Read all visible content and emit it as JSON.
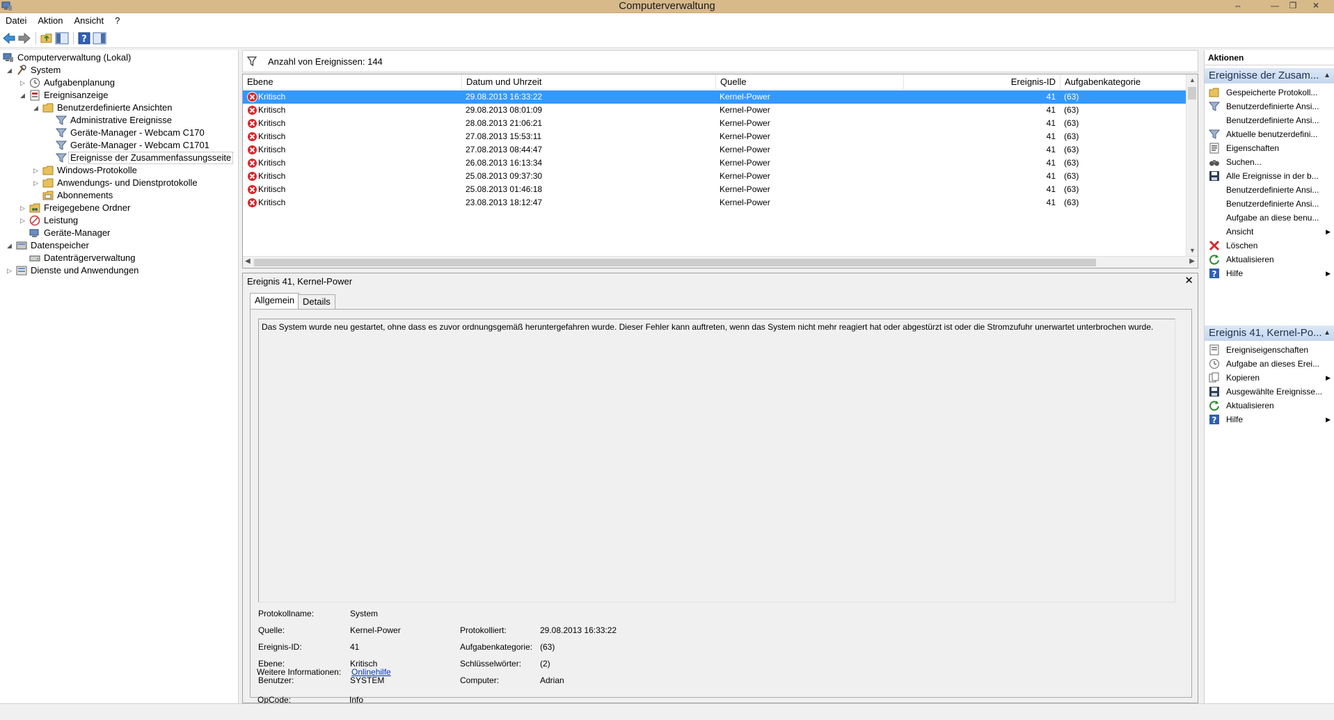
{
  "window": {
    "title": "Computerverwaltung",
    "buttons": {
      "resize": "⇔",
      "minimize": "—",
      "maximize": "❐",
      "close": "✕"
    }
  },
  "menu": {
    "items": [
      "Datei",
      "Aktion",
      "Ansicht",
      "?"
    ]
  },
  "tree": {
    "items": [
      {
        "label": "Computerverwaltung (Lokal)",
        "icon": "computer-management-icon"
      },
      {
        "label": "System",
        "icon": "system-tools-icon"
      },
      {
        "label": "Aufgabenplanung",
        "icon": "clock-icon"
      },
      {
        "label": "Ereignisanzeige",
        "icon": "event-viewer-icon"
      },
      {
        "label": "Benutzerdefinierte Ansichten",
        "icon": "folder-icon"
      },
      {
        "label": "Administrative Ereignisse",
        "icon": "filter-icon"
      },
      {
        "label": "Geräte-Manager - Webcam C170",
        "icon": "filter-icon"
      },
      {
        "label": "Geräte-Manager - Webcam C1701",
        "icon": "filter-icon"
      },
      {
        "label": "Ereignisse der Zusammenfassungsseite",
        "icon": "filter-icon"
      },
      {
        "label": "Windows-Protokolle",
        "icon": "folder-icon"
      },
      {
        "label": "Anwendungs- und Dienstprotokolle",
        "icon": "folder-icon"
      },
      {
        "label": "Abonnements",
        "icon": "subscription-icon"
      },
      {
        "label": "Freigegebene Ordner",
        "icon": "shared-folder-icon"
      },
      {
        "label": "Leistung",
        "icon": "performance-icon"
      },
      {
        "label": "Geräte-Manager",
        "icon": "device-manager-icon"
      },
      {
        "label": "Datenspeicher",
        "icon": "storage-icon"
      },
      {
        "label": "Datenträgerverwaltung",
        "icon": "disk-icon"
      },
      {
        "label": "Dienste und Anwendungen",
        "icon": "services-icon"
      }
    ]
  },
  "events": {
    "filter_text": "Anzahl von Ereignissen: 144",
    "columns": [
      "Ebene",
      "Datum und Uhrzeit",
      "Quelle",
      "Ereignis-ID",
      "Aufgabenkategorie"
    ],
    "rows": [
      {
        "level": "Kritisch",
        "datetime": "29.08.2013 16:33:22",
        "source": "Kernel-Power",
        "id": "41",
        "category": "(63)"
      },
      {
        "level": "Kritisch",
        "datetime": "29.08.2013 08:01:09",
        "source": "Kernel-Power",
        "id": "41",
        "category": "(63)"
      },
      {
        "level": "Kritisch",
        "datetime": "28.08.2013 21:06:21",
        "source": "Kernel-Power",
        "id": "41",
        "category": "(63)"
      },
      {
        "level": "Kritisch",
        "datetime": "27.08.2013 15:53:11",
        "source": "Kernel-Power",
        "id": "41",
        "category": "(63)"
      },
      {
        "level": "Kritisch",
        "datetime": "27.08.2013 08:44:47",
        "source": "Kernel-Power",
        "id": "41",
        "category": "(63)"
      },
      {
        "level": "Kritisch",
        "datetime": "26.08.2013 16:13:34",
        "source": "Kernel-Power",
        "id": "41",
        "category": "(63)"
      },
      {
        "level": "Kritisch",
        "datetime": "25.08.2013 09:37:30",
        "source": "Kernel-Power",
        "id": "41",
        "category": "(63)"
      },
      {
        "level": "Kritisch",
        "datetime": "25.08.2013 01:46:18",
        "source": "Kernel-Power",
        "id": "41",
        "category": "(63)"
      },
      {
        "level": "Kritisch",
        "datetime": "23.08.2013 18:12:47",
        "source": "Kernel-Power",
        "id": "41",
        "category": "(63)"
      }
    ]
  },
  "detail": {
    "title": "Ereignis 41, Kernel-Power",
    "close": "✕",
    "tabs": [
      "Allgemein",
      "Details"
    ],
    "message": "Das System wurde neu gestartet, ohne dass es zuvor ordnungsgemäß heruntergefahren wurde. Dieser Fehler kann auftreten, wenn das System nicht mehr reagiert hat oder abgestürzt ist oder die Stromzufuhr unerwartet unterbrochen wurde.",
    "props": {
      "protokollname_label": "Protokollname:",
      "protokollname": "System",
      "quelle_label": "Quelle:",
      "quelle": "Kernel-Power",
      "protokolliert_label": "Protokolliert:",
      "protokolliert": "29.08.2013 16:33:22",
      "ereignisid_label": "Ereignis-ID:",
      "ereignisid": "41",
      "aufgabenkategorie_label": "Aufgabenkategorie:",
      "aufgabenkategorie": "(63)",
      "ebene_label": "Ebene:",
      "ebene": "Kritisch",
      "schluesselwoerter_label": "Schlüsselwörter:",
      "schluesselwoerter": "(2)",
      "benutzer_label": "Benutzer:",
      "benutzer": "SYSTEM",
      "computer_label": "Computer:",
      "computer": "Adrian",
      "opcode_label": "OpCode:",
      "opcode": "Info",
      "weitere_label": "Weitere Informationen:",
      "weitere_link": "Onlinehilfe"
    }
  },
  "actions": {
    "header": "Aktionen",
    "section1": {
      "title": "Ereignisse der Zusam...",
      "items": [
        {
          "label": "Gespeicherte Protokoll...",
          "icon": "open-folder-icon"
        },
        {
          "label": "Benutzerdefinierte Ansi...",
          "icon": "filter-icon"
        },
        {
          "label": "Benutzerdefinierte Ansi...",
          "icon": ""
        },
        {
          "label": "Aktuelle benutzerdefini...",
          "icon": "filter-icon"
        },
        {
          "label": "Eigenschaften",
          "icon": "properties-icon"
        },
        {
          "label": "Suchen...",
          "icon": "binoculars-icon"
        },
        {
          "label": "Alle Ereignisse in der b...",
          "icon": "save-icon"
        },
        {
          "label": "Benutzerdefinierte Ansi...",
          "icon": ""
        },
        {
          "label": "Benutzerdefinierte Ansi...",
          "icon": ""
        },
        {
          "label": "Aufgabe an diese benu...",
          "icon": ""
        },
        {
          "label": "Ansicht",
          "icon": "",
          "submenu": "▶"
        },
        {
          "label": "Löschen",
          "icon": "delete-icon"
        },
        {
          "label": "Aktualisieren",
          "icon": "refresh-icon"
        },
        {
          "label": "Hilfe",
          "icon": "help-icon",
          "submenu": "▶"
        }
      ]
    },
    "section2": {
      "title": "Ereignis 41, Kernel-Po...",
      "items": [
        {
          "label": "Ereigniseigenschaften",
          "icon": "event-properties-icon"
        },
        {
          "label": "Aufgabe an dieses Erei...",
          "icon": "task-icon"
        },
        {
          "label": "Kopieren",
          "icon": "copy-icon",
          "submenu": "▶"
        },
        {
          "label": "Ausgewählte Ereignisse...",
          "icon": "save-icon"
        },
        {
          "label": "Aktualisieren",
          "icon": "refresh-icon"
        },
        {
          "label": "Hilfe",
          "icon": "help-icon",
          "submenu": "▶"
        }
      ]
    }
  },
  "colors": {
    "selection": "#3399ff",
    "titlebar": "#d7b98a",
    "critical": "#d9262a",
    "actions_section": "#c5d7ee"
  }
}
